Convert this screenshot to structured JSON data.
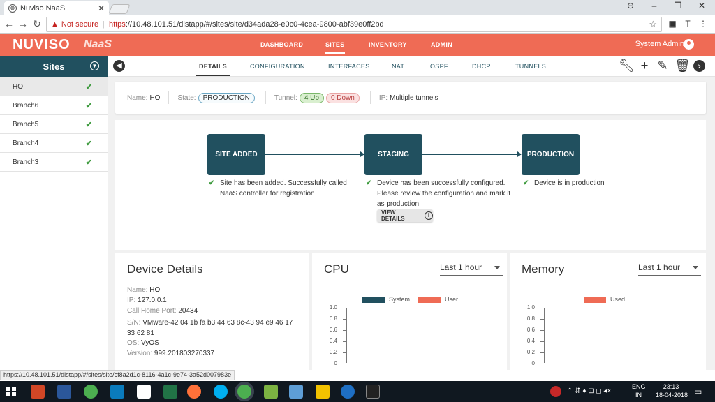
{
  "browser": {
    "tab_title": "Nuviso NaaS",
    "tab_close": "✕",
    "not_secure": "Not secure",
    "url_scheme": "https",
    "url_rest": "://10.48.101.51/distapp/#/sites/site/d34ada28-e0c0-4cea-9800-abf39e0ff2bd",
    "status_link": "https://10.48.101.51/distapp/#/sites/site/cf8a2d1c-8116-4a1c-9e74-3a52d007983e"
  },
  "header": {
    "brand": "NUVISO",
    "product": "NaaS",
    "nav": [
      "DASHBOARD",
      "SITES",
      "INVENTORY",
      "ADMIN"
    ],
    "active_nav": "SITES",
    "user": "System Admin"
  },
  "sidebar": {
    "title": "Sites",
    "items": [
      {
        "label": "HO",
        "selected": true
      },
      {
        "label": "Branch6",
        "selected": false
      },
      {
        "label": "Branch5",
        "selected": false
      },
      {
        "label": "Branch4",
        "selected": false
      },
      {
        "label": "Branch3",
        "selected": false
      }
    ]
  },
  "subnav": {
    "tabs": [
      "DETAILS",
      "CONFIGURATION",
      "INTERFACES",
      "NAT",
      "OSPF",
      "DHCP",
      "TUNNELS"
    ],
    "active": "DETAILS"
  },
  "summary": {
    "name_label": "Name:",
    "name_value": "HO",
    "state_label": "State:",
    "state_value": "PRODUCTION",
    "tunnel_label": "Tunnel:",
    "tunnel_up": "4 Up",
    "tunnel_down": "0 Down",
    "ip_label": "IP:",
    "ip_value": "Multiple tunnels"
  },
  "workflow": {
    "steps": [
      {
        "title": "SITE ADDED",
        "desc": "Site has been added. Successfully called NaaS controller for registration"
      },
      {
        "title": "STAGING",
        "desc": "Device has been successfully configured. Please review the configuration and mark it as production"
      },
      {
        "title": "PRODUCTION",
        "desc": "Device is in production"
      }
    ],
    "view_details": "VIEW DETAILS"
  },
  "device": {
    "title": "Device Details",
    "name_label": "Name:",
    "name": "HO",
    "ip_label": "IP:",
    "ip": "127.0.0.1",
    "port_label": "Call Home Port:",
    "port": "20434",
    "sn_label": "S/N:",
    "sn": "VMware-42 04 1b fa b3 44 63 8c-43 94 e9 46 17 33 62 81",
    "os_label": "OS:",
    "os": "VyOS",
    "version_label": "Version:",
    "version": "999.201803270337"
  },
  "cpu": {
    "title": "CPU",
    "range": "Last 1 hour",
    "legend": [
      {
        "name": "System",
        "color": "#21505f"
      },
      {
        "name": "User",
        "color": "#ef6b55"
      }
    ],
    "yticks": [
      "1.0",
      "0.8",
      "0.6",
      "0.4",
      "0.2",
      "0"
    ]
  },
  "memory": {
    "title": "Memory",
    "range": "Last 1 hour",
    "legend": [
      {
        "name": "Used",
        "color": "#ef6b55"
      }
    ],
    "yticks": [
      "1.0",
      "0.8",
      "0.6",
      "0.4",
      "0.2",
      "0"
    ]
  },
  "taskbar": {
    "lang": "ENG",
    "region": "IN",
    "time": "23:13",
    "date": "18-04-2018"
  }
}
